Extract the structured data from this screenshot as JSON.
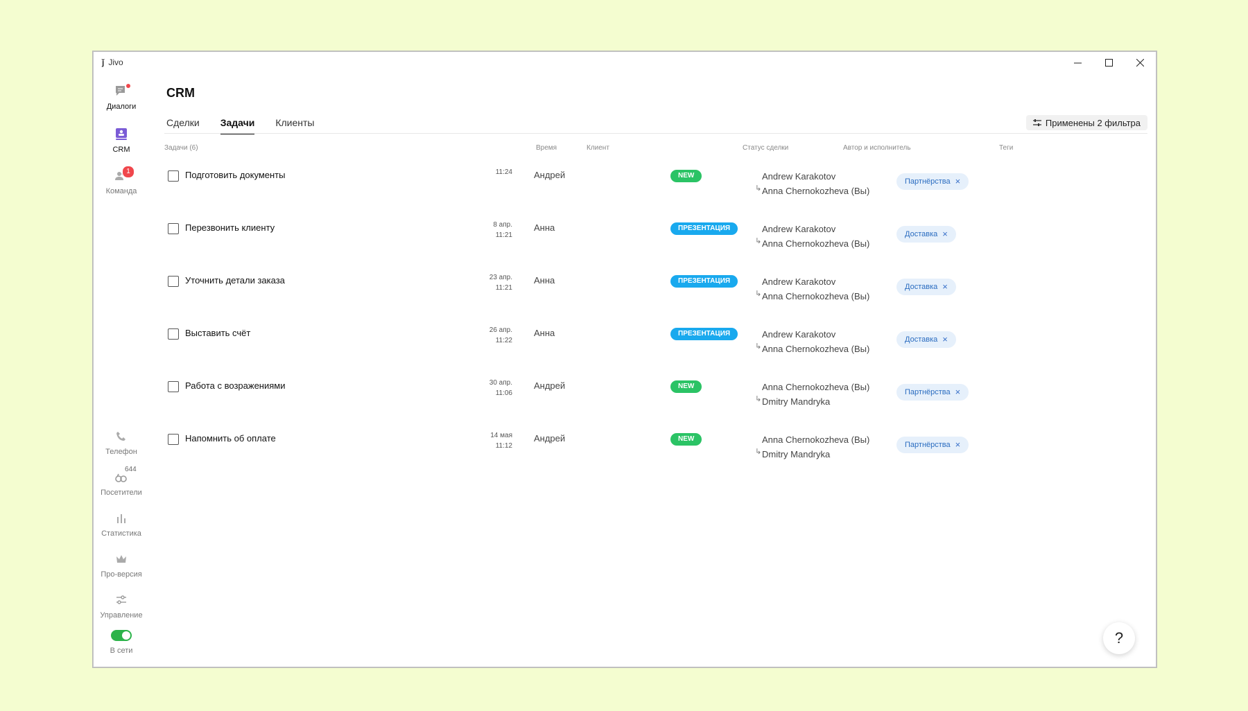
{
  "window": {
    "app_name": "Jivo",
    "logo_glyph": "ǰ",
    "controls": {
      "minimize": "minimize-icon",
      "maximize": "maximize-icon",
      "close": "close-icon"
    }
  },
  "sidebar": {
    "top_items": [
      {
        "label": "Диалоги",
        "icon": "chat-icon",
        "active": true
      },
      {
        "label": "CRM",
        "icon": "crm-icon",
        "active": true
      },
      {
        "label": "Команда",
        "icon": "team-icon",
        "badge": "1"
      }
    ],
    "bottom_items": [
      {
        "label": "Телефон",
        "icon": "phone-icon"
      },
      {
        "label": "Посетители",
        "icon": "visitors-icon",
        "count": "644"
      },
      {
        "label": "Статистика",
        "icon": "statistics-icon"
      },
      {
        "label": "Про-версия",
        "icon": "crown-icon"
      },
      {
        "label": "Управление",
        "icon": "settings-sliders-icon"
      }
    ],
    "status_label": "В сети"
  },
  "main": {
    "title": "CRM",
    "tabs": [
      {
        "label": "Сделки",
        "active": false
      },
      {
        "label": "Задачи",
        "active": true
      },
      {
        "label": "Клиенты",
        "active": false
      }
    ],
    "filter_label": "Применены 2 фильтра",
    "columns": {
      "tasks": "Задачи (6)",
      "time": "Время",
      "client": "Клиент",
      "status": "Статус сделки",
      "people": "Автор и исполнитель",
      "tags": "Теги"
    },
    "tasks": [
      {
        "title": "Подготовить документы",
        "date": "",
        "time": "11:24",
        "client": "Андрей",
        "status": "NEW",
        "author": "Andrew Karakotov",
        "assignee": "Anna Chernokozheva (Вы)",
        "tag": "Партнёрства"
      },
      {
        "title": "Перезвонить клиенту",
        "date": "8 апр.",
        "time": "11:21",
        "client": "Анна",
        "status": "ПРЕЗЕНТАЦИЯ",
        "author": "Andrew Karakotov",
        "assignee": "Anna Chernokozheva (Вы)",
        "tag": "Доставка"
      },
      {
        "title": "Уточнить детали заказа",
        "date": "23 апр.",
        "time": "11:21",
        "client": "Анна",
        "status": "ПРЕЗЕНТАЦИЯ",
        "author": "Andrew Karakotov",
        "assignee": "Anna Chernokozheva (Вы)",
        "tag": "Доставка"
      },
      {
        "title": "Выставить счёт",
        "date": "26 апр.",
        "time": "11:22",
        "client": "Анна",
        "status": "ПРЕЗЕНТАЦИЯ",
        "author": "Andrew Karakotov",
        "assignee": "Anna Chernokozheva (Вы)",
        "tag": "Доставка"
      },
      {
        "title": "Работа с возражениями",
        "date": "30 апр.",
        "time": "11:06",
        "client": "Андрей",
        "status": "NEW",
        "author": "Anna Chernokozheva (Вы)",
        "assignee": "Dmitry Mandryka",
        "tag": "Партнёрства"
      },
      {
        "title": "Напомнить об оплате",
        "date": "14 мая",
        "time": "11:12",
        "client": "Андрей",
        "status": "NEW",
        "author": "Anna Chernokozheva (Вы)",
        "assignee": "Dmitry Mandryka",
        "tag": "Партнёрства"
      }
    ],
    "help_label": "?"
  },
  "colors": {
    "accent": "#7b5cd6",
    "status_new": "#2bc365",
    "status_presentation": "#19a9ee",
    "tag_bg": "#e6f0fb",
    "online": "#2cb34a",
    "badge": "#f0474c"
  }
}
